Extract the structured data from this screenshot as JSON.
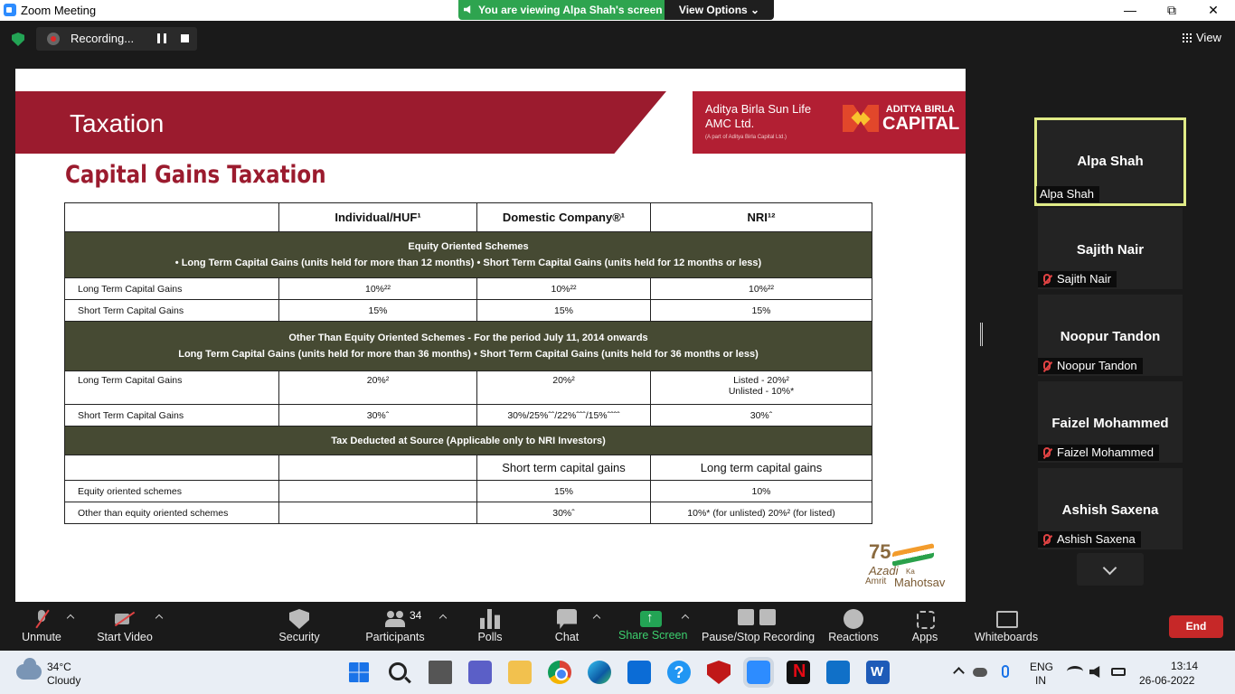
{
  "window": {
    "title": "Zoom Meeting",
    "minimize": "—",
    "maximize": "⧉",
    "close": "✕"
  },
  "share_banner": {
    "text": "You are viewing Alpa Shah's screen",
    "view_options": "View Options ⌄"
  },
  "recording": {
    "label": "Recording..."
  },
  "view_button": "View",
  "slide": {
    "section_title": "Taxation",
    "company_name": "Aditya Birla Sun Life AMC Ltd.",
    "company_sub": "(A part of Aditya Birla Capital Ltd.)",
    "brand_line1": "ADITYA BIRLA",
    "brand_line2": "CAPITAL",
    "heading": "Capital Gains Taxation",
    "table": {
      "headers": [
        "",
        "Individual/HUF¹",
        "Domestic Company®¹",
        "NRI¹²"
      ],
      "sections": [
        {
          "title_lines": [
            "Equity Oriented Schemes",
            "• Long Term Capital Gains (units held for more than 12 months) • Short Term Capital Gains (units held for 12 months or less)"
          ],
          "rows": [
            [
              "Long Term Capital Gains",
              "10%²²",
              "10%²²",
              "10%²²"
            ],
            [
              "Short Term Capital Gains",
              "15%",
              "15%",
              "15%"
            ]
          ]
        },
        {
          "title_lines": [
            "Other Than Equity Oriented Schemes - For the period July 11, 2014 onwards",
            "Long Term Capital Gains (units held for more than 36 months) • Short Term Capital Gains (units held for 36 months or less)"
          ],
          "rows": [
            [
              "Long Term Capital Gains",
              "20%²",
              "20%²",
              "Listed - 20%²",
              "Unlisted - 10%*"
            ],
            [
              "Short Term Capital Gains",
              "30%ˆ",
              "30%/25%ˆˆ/22%ˆˆˆ/15%ˆˆˆˆ",
              "30%ˆ"
            ]
          ]
        }
      ],
      "tds_title": "Tax Deducted at Source (Applicable only to NRI Investors)",
      "tds_headers": [
        "",
        "",
        "Short term capital gains",
        "Long term capital gains"
      ],
      "tds_rows": [
        [
          "Equity oriented schemes",
          "",
          "15%",
          "10%"
        ],
        [
          "Other than equity oriented schemes",
          "",
          "30%ˆ",
          "10%* (for unlisted) 20%² (for listed)"
        ]
      ]
    },
    "azadi": {
      "num": "75",
      "line1": "Azadi",
      "ka": "Ka",
      "line2": "Amrit",
      "line3": "Mahotsav"
    }
  },
  "participants": [
    {
      "name": "Alpa Shah",
      "label": "Alpa Shah",
      "muted": false
    },
    {
      "name": "Sajith Nair",
      "label": "Sajith Nair",
      "muted": true
    },
    {
      "name": "Noopur Tandon",
      "label": "Noopur Tandon",
      "muted": true
    },
    {
      "name": "Faizel Mohammed",
      "label": "Faizel Mohammed",
      "muted": true
    },
    {
      "name": "Ashish Saxena",
      "label": "Ashish Saxena",
      "muted": true
    }
  ],
  "toolbar": {
    "unmute": "Unmute",
    "start_video": "Start Video",
    "security": "Security",
    "participants": "Participants",
    "participant_count": "34",
    "polls": "Polls",
    "chat": "Chat",
    "share_screen": "Share Screen",
    "record": "Pause/Stop Recording",
    "reactions": "Reactions",
    "apps": "Apps",
    "whiteboards": "Whiteboards",
    "end": "End"
  },
  "colors": {
    "accent_green": "#23a455",
    "end_red": "#c62828",
    "active_speaker": "#e0eb86",
    "slide_maroon": "#9b1b2e",
    "table_section": "#464a33"
  },
  "taskbar": {
    "weather_temp": "34°C",
    "weather_desc": "Cloudy",
    "lang_1": "ENG",
    "lang_2": "IN",
    "time": "13:14",
    "date": "26-06-2022"
  }
}
